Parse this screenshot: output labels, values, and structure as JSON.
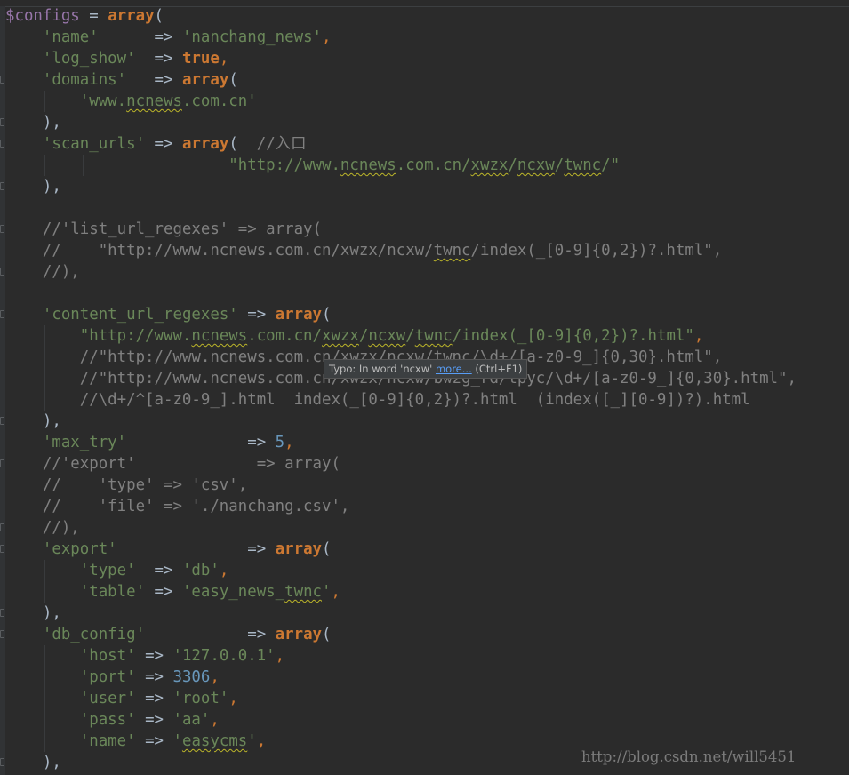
{
  "editor": {
    "theme": {
      "background": "#2b2b2b",
      "variable": "#9876aa",
      "keyword": "#cc7832",
      "string": "#6a8759",
      "number": "#6897bb",
      "comment": "#808080",
      "text": "#a9b7c6"
    },
    "lines": [
      {
        "fold": false,
        "tokens": [
          [
            "var",
            "$configs"
          ],
          [
            "plain",
            " = "
          ],
          [
            "kw",
            "array"
          ],
          [
            "plain",
            "("
          ]
        ]
      },
      {
        "fold": false,
        "tokens": [
          [
            "plain",
            "    "
          ],
          [
            "str",
            "'name'"
          ],
          [
            "plain",
            "      => "
          ],
          [
            "str",
            "'nanchang_news'"
          ],
          [
            "punc",
            ","
          ]
        ]
      },
      {
        "fold": false,
        "tokens": [
          [
            "plain",
            "    "
          ],
          [
            "str",
            "'log_show'"
          ],
          [
            "plain",
            "  => "
          ],
          [
            "kw",
            "true"
          ],
          [
            "punc",
            ","
          ]
        ]
      },
      {
        "fold": true,
        "tokens": [
          [
            "plain",
            "    "
          ],
          [
            "str",
            "'domains'"
          ],
          [
            "plain",
            "   => "
          ],
          [
            "kw",
            "array"
          ],
          [
            "plain",
            "("
          ]
        ]
      },
      {
        "fold": false,
        "tokens": [
          [
            "plain",
            "        "
          ],
          [
            "str",
            "'www."
          ],
          [
            "strtypo",
            "ncnews"
          ],
          [
            "str",
            ".com.cn'"
          ]
        ]
      },
      {
        "fold": true,
        "tokens": [
          [
            "plain",
            "    ),"
          ]
        ]
      },
      {
        "fold": true,
        "tokens": [
          [
            "plain",
            "    "
          ],
          [
            "str",
            "'scan_urls'"
          ],
          [
            "plain",
            " => "
          ],
          [
            "kw",
            "array"
          ],
          [
            "plain",
            "(  "
          ],
          [
            "com",
            "//入口"
          ]
        ]
      },
      {
        "fold": false,
        "tokens": [
          [
            "plain",
            "                        "
          ],
          [
            "str",
            "\"http://www."
          ],
          [
            "strtypo",
            "ncnews"
          ],
          [
            "str",
            ".com.cn/"
          ],
          [
            "strtypo",
            "xwzx"
          ],
          [
            "str",
            "/"
          ],
          [
            "strtypo",
            "ncxw"
          ],
          [
            "str",
            "/"
          ],
          [
            "strtypo",
            "twnc"
          ],
          [
            "str",
            "/\""
          ]
        ]
      },
      {
        "fold": true,
        "tokens": [
          [
            "plain",
            "    ),"
          ]
        ]
      },
      {
        "fold": false,
        "tokens": [
          [
            "plain",
            ""
          ]
        ]
      },
      {
        "fold": true,
        "tokens": [
          [
            "com",
            "    //'list_url_regexes' => array("
          ]
        ]
      },
      {
        "fold": false,
        "tokens": [
          [
            "com",
            "    //    \"http://www.ncnews.com.cn/xwzx/ncxw/"
          ],
          [
            "comtypo",
            "twnc"
          ],
          [
            "com",
            "/index(_[0-9]{0,2})?.html\","
          ]
        ]
      },
      {
        "fold": true,
        "tokens": [
          [
            "com",
            "    //),"
          ]
        ]
      },
      {
        "fold": false,
        "tokens": [
          [
            "plain",
            ""
          ]
        ]
      },
      {
        "fold": true,
        "tokens": [
          [
            "plain",
            "    "
          ],
          [
            "str",
            "'content_url_regexes'"
          ],
          [
            "plain",
            " => "
          ],
          [
            "kw",
            "array"
          ],
          [
            "plain",
            "("
          ]
        ]
      },
      {
        "fold": false,
        "tokens": [
          [
            "plain",
            "        "
          ],
          [
            "str",
            "\"http://www."
          ],
          [
            "strtypo",
            "ncnews"
          ],
          [
            "str",
            ".com.cn/"
          ],
          [
            "strtypo",
            "xwzx"
          ],
          [
            "str",
            "/"
          ],
          [
            "strtypo",
            "ncxw"
          ],
          [
            "str",
            "/"
          ],
          [
            "strtypo",
            "twnc"
          ],
          [
            "str",
            "/index(_[0-9]{0,2})?.html\""
          ],
          [
            "punc",
            ","
          ]
        ]
      },
      {
        "fold": false,
        "tokens": [
          [
            "com",
            "        //\"http://www.ncnews.com.cn/xwzx/ncxw/twnc/\\d+/[a-z0-9_]{0,30}.html\","
          ]
        ]
      },
      {
        "fold": false,
        "tokens": [
          [
            "com",
            "        //\"http://www.ncnews.com.cn/xwzx/ncxw/bwzg_rd/tpyc/\\d+/[a-z0-9_]{0,30}.html\","
          ]
        ]
      },
      {
        "fold": false,
        "tokens": [
          [
            "com",
            "        //\\d+/^[a-z0-9_].html  index(_[0-9]{0,2})?.html  (index([_][0-9])?).html"
          ]
        ]
      },
      {
        "fold": true,
        "tokens": [
          [
            "plain",
            "    ),"
          ]
        ]
      },
      {
        "fold": false,
        "tokens": [
          [
            "plain",
            "    "
          ],
          [
            "str",
            "'max_try'"
          ],
          [
            "plain",
            "             => "
          ],
          [
            "num",
            "5"
          ],
          [
            "punc",
            ","
          ]
        ]
      },
      {
        "fold": true,
        "tokens": [
          [
            "com",
            "    //'export'             => array("
          ]
        ]
      },
      {
        "fold": false,
        "tokens": [
          [
            "com",
            "    //    'type' => 'csv',"
          ]
        ]
      },
      {
        "fold": false,
        "tokens": [
          [
            "com",
            "    //    'file' => './nanchang.csv',"
          ]
        ]
      },
      {
        "fold": true,
        "tokens": [
          [
            "com",
            "    //),"
          ]
        ]
      },
      {
        "fold": true,
        "tokens": [
          [
            "plain",
            "    "
          ],
          [
            "str",
            "'export'"
          ],
          [
            "plain",
            "              => "
          ],
          [
            "kw",
            "array"
          ],
          [
            "plain",
            "("
          ]
        ]
      },
      {
        "fold": false,
        "tokens": [
          [
            "plain",
            "        "
          ],
          [
            "str",
            "'type'"
          ],
          [
            "plain",
            "  => "
          ],
          [
            "str",
            "'db'"
          ],
          [
            "punc",
            ","
          ]
        ]
      },
      {
        "fold": false,
        "tokens": [
          [
            "plain",
            "        "
          ],
          [
            "str",
            "'table'"
          ],
          [
            "plain",
            " => "
          ],
          [
            "str",
            "'easy_news_"
          ],
          [
            "strtypo",
            "twnc"
          ],
          [
            "str",
            "'"
          ],
          [
            "punc",
            ","
          ]
        ]
      },
      {
        "fold": true,
        "tokens": [
          [
            "plain",
            "    ),"
          ]
        ]
      },
      {
        "fold": true,
        "tokens": [
          [
            "plain",
            "    "
          ],
          [
            "str",
            "'db_config'"
          ],
          [
            "plain",
            "           => "
          ],
          [
            "kw",
            "array"
          ],
          [
            "plain",
            "("
          ]
        ]
      },
      {
        "fold": false,
        "tokens": [
          [
            "plain",
            "        "
          ],
          [
            "str",
            "'host'"
          ],
          [
            "plain",
            " => "
          ],
          [
            "str",
            "'127.0.0.1'"
          ],
          [
            "punc",
            ","
          ]
        ]
      },
      {
        "fold": false,
        "tokens": [
          [
            "plain",
            "        "
          ],
          [
            "str",
            "'port'"
          ],
          [
            "plain",
            " => "
          ],
          [
            "num",
            "3306"
          ],
          [
            "punc",
            ","
          ]
        ]
      },
      {
        "fold": false,
        "tokens": [
          [
            "plain",
            "        "
          ],
          [
            "str",
            "'user'"
          ],
          [
            "plain",
            " => "
          ],
          [
            "str",
            "'root'"
          ],
          [
            "punc",
            ","
          ]
        ]
      },
      {
        "fold": false,
        "tokens": [
          [
            "plain",
            "        "
          ],
          [
            "str",
            "'pass'"
          ],
          [
            "plain",
            " => "
          ],
          [
            "str",
            "'aa'"
          ],
          [
            "punc",
            ","
          ]
        ]
      },
      {
        "fold": false,
        "tokens": [
          [
            "plain",
            "        "
          ],
          [
            "str",
            "'name'"
          ],
          [
            "plain",
            " => "
          ],
          [
            "str",
            "'"
          ],
          [
            "strtypo",
            "easycms"
          ],
          [
            "str",
            "'"
          ],
          [
            "punc",
            ","
          ]
        ]
      },
      {
        "fold": true,
        "tokens": [
          [
            "plain",
            "    ),"
          ]
        ]
      }
    ]
  },
  "tooltip": {
    "prefix": "Typo: In word 'ncxw' ",
    "link": "more...",
    "shortcut": " (Ctrl+F1)"
  },
  "watermark": "http://blog.csdn.net/will5451"
}
